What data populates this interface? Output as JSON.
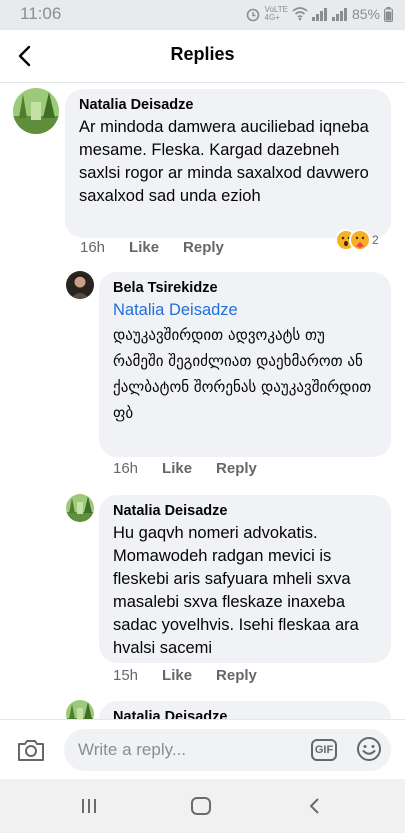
{
  "status": {
    "time": "11:06",
    "net": "VoLTE",
    "lte": "4G+",
    "battery": "85%"
  },
  "header": {
    "title": "Replies"
  },
  "comments": [
    {
      "author": "Natalia Deisadze",
      "text": "Ar mindoda damwera auciliebad iqneba mesame. Fleska. Kargad dazebneh saxlsi rogor ar minda saxalxod davwero saxalxod sad unda ezioh",
      "time": "16h",
      "like": "Like",
      "reply": "Reply",
      "reaction_count": "2"
    },
    {
      "author": "Bela Tsirekidze",
      "mention": "Natalia Deisadze",
      "text": "დაუკავშირდით ადვოკატს თუ რამეში შეგიძლიათ დაეხმაროთ ან ქალბატონ შორენას დაუკავშირდით ფბ",
      "time": "16h",
      "like": "Like",
      "reply": "Reply"
    },
    {
      "author": "Natalia Deisadze",
      "text": "Hu gaqvh nomeri advokatis. Momawodeh radgan mevici is fleskebi aris safyuara mheli sxva masalebi sxva fleskaze inaxeba sadac yovelhvis. Isehi fleskaa ara hvalsi sacemi",
      "time": "15h",
      "like": "Like",
      "reply": "Reply"
    },
    {
      "author": "Natalia Deisadze"
    }
  ],
  "composer": {
    "placeholder": "Write a reply...",
    "gif": "GIF"
  },
  "colors": {
    "bubble": "#f0f2f5",
    "mention": "#216fdb",
    "meta": "#65676b"
  }
}
